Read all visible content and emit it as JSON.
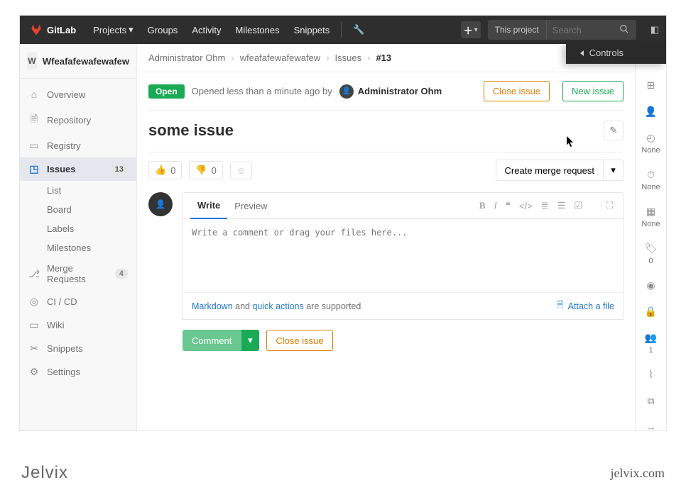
{
  "topnav": {
    "brand": "GitLab",
    "items": [
      "Projects",
      "Groups",
      "Activity",
      "Milestones",
      "Snippets"
    ],
    "search_scope": "This project",
    "search_placeholder": "Search"
  },
  "controls_overlay": "Controls",
  "sidebar": {
    "project_initial": "W",
    "project_name": "Wfeafafewafewafew",
    "items": [
      {
        "icon": "home-icon",
        "label": "Overview"
      },
      {
        "icon": "repo-icon",
        "label": "Repository"
      },
      {
        "icon": "registry-icon",
        "label": "Registry"
      },
      {
        "icon": "issues-icon",
        "label": "Issues",
        "badge": "13",
        "active": true
      },
      {
        "icon": "merge-icon",
        "label": "Merge Requests",
        "badge": "4"
      },
      {
        "icon": "ci-icon",
        "label": "CI / CD"
      },
      {
        "icon": "wiki-icon",
        "label": "Wiki"
      },
      {
        "icon": "snippets-icon",
        "label": "Snippets"
      },
      {
        "icon": "settings-icon",
        "label": "Settings"
      }
    ],
    "issue_sub": [
      "List",
      "Board",
      "Labels",
      "Milestones"
    ]
  },
  "breadcrumb": [
    "Administrator Ohm",
    "wfeafafewafewafew",
    "Issues",
    "#13"
  ],
  "issue": {
    "status_badge": "Open",
    "opened_text": "Opened less than a minute ago by",
    "author": "Administrator Ohm",
    "close_btn": "Close issue",
    "new_btn": "New issue",
    "title": "some issue",
    "thumbs_up": "0",
    "thumbs_down": "0",
    "create_mr": "Create merge request"
  },
  "comment": {
    "tab_write": "Write",
    "tab_preview": "Preview",
    "placeholder": "Write a comment or drag your files here...",
    "markdown_label": "Markdown",
    "help_middle": " and ",
    "quick_actions_label": "quick actions",
    "help_suffix": " are supported",
    "attach": "Attach a file",
    "comment_btn": "Comment",
    "close_btn": "Close issue"
  },
  "aside": {
    "none": "None",
    "labels_count": "0",
    "participants_count": "1"
  },
  "brand": {
    "left": "Jelvix",
    "right": "jelvix.com"
  }
}
